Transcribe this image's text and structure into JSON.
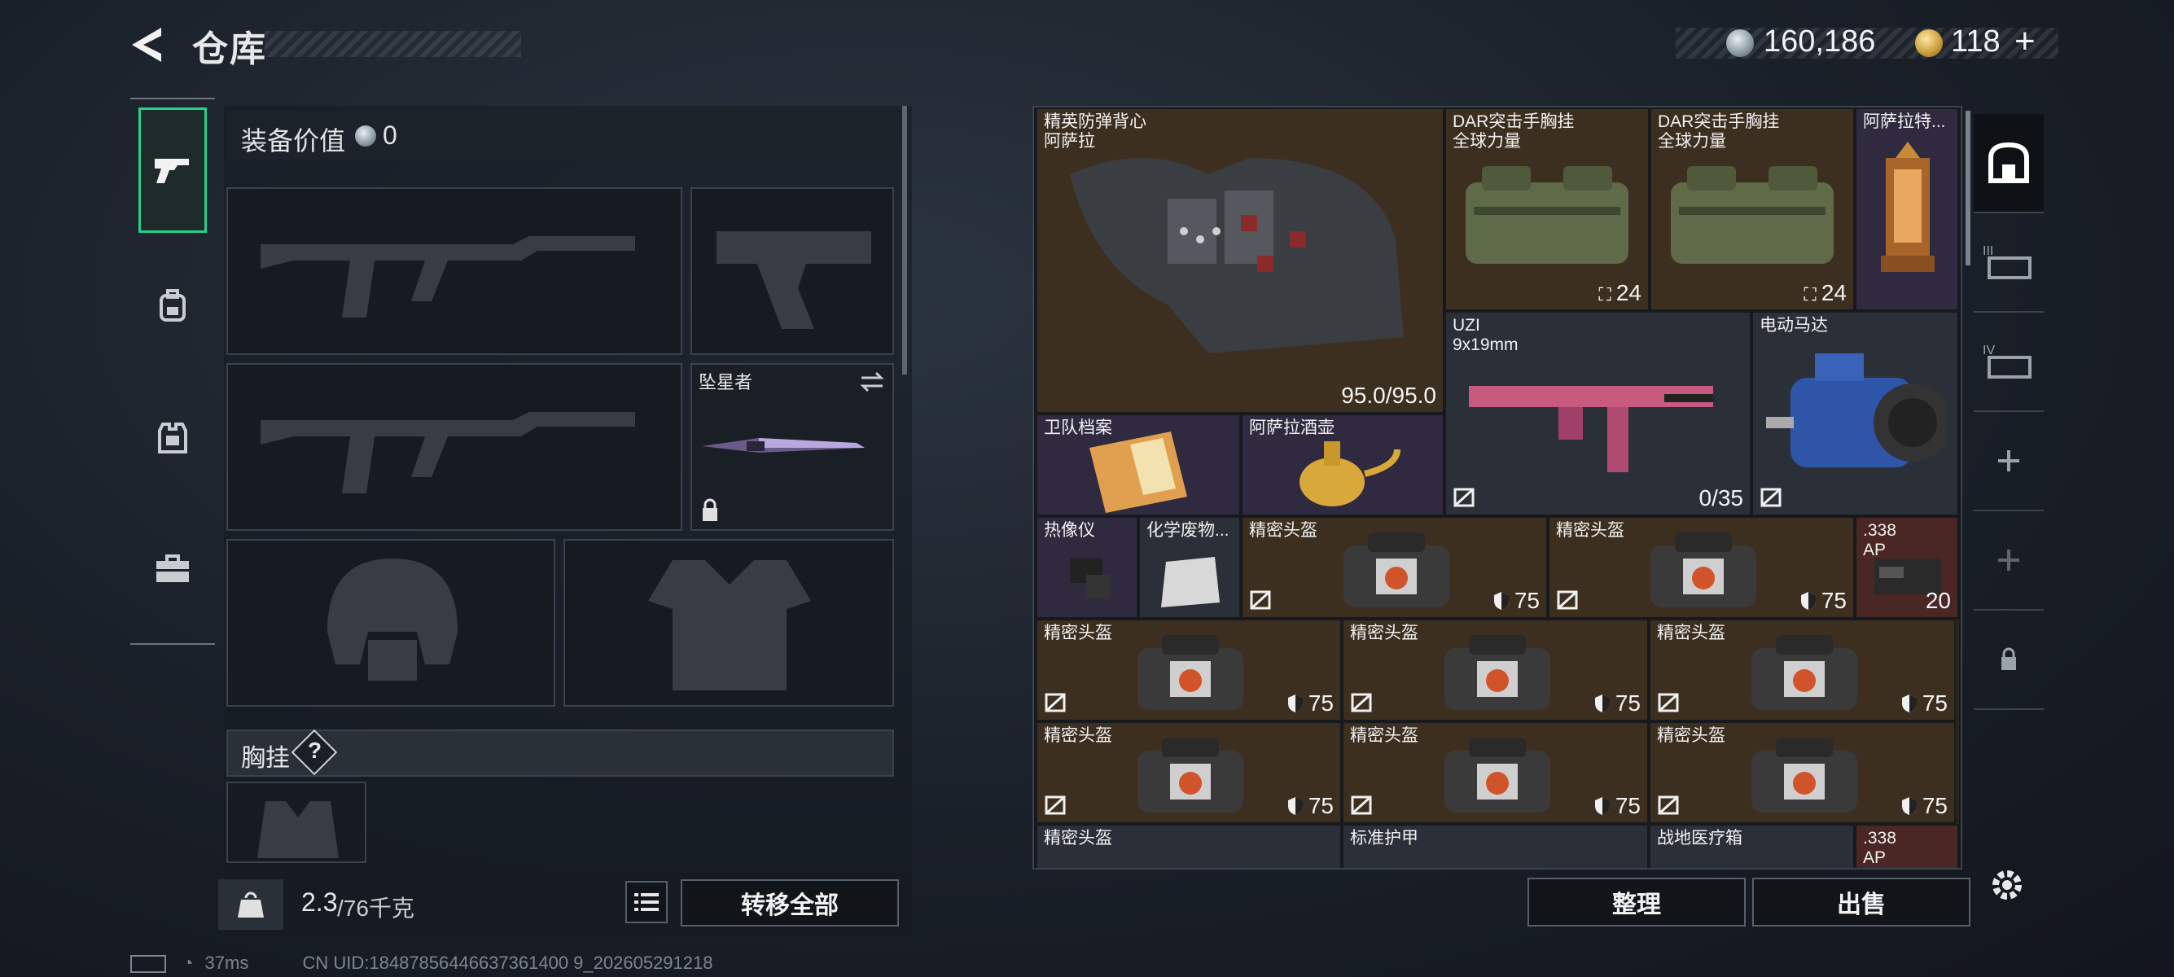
{
  "header": {
    "title": "仓库",
    "silver_amount": "160,186",
    "gold_amount": "118",
    "gold_plus": "+"
  },
  "left": {
    "equip_value_label": "装备价值",
    "equip_value": "0",
    "melee_name": "坠星者",
    "chest_rig_label": "胸挂",
    "chest_rig_help": "?",
    "weight_current": "2.3",
    "weight_max": "/76千克",
    "transfer_all": "转移全部"
  },
  "inventory": {
    "items": [
      {
        "name": "精英防弹背心\n阿萨拉",
        "br": "95.0/95.0"
      },
      {
        "name": "DAR突击手胸挂\n全球力量",
        "br": "24"
      },
      {
        "name": "DAR突击手胸挂\n全球力量",
        "br": "24"
      },
      {
        "name": "阿萨拉特...",
        "br": ""
      },
      {
        "name": "UZI\n9x19mm",
        "br": "0/35"
      },
      {
        "name": "电动马达",
        "br": ""
      },
      {
        "name": "卫队档案",
        "br": ""
      },
      {
        "name": "阿萨拉酒壶",
        "br": ""
      },
      {
        "name": "热像仪",
        "br": ""
      },
      {
        "name": "化学废物...",
        "br": ""
      },
      {
        "name": "精密头盔",
        "br": "75"
      },
      {
        "name": "精密头盔",
        "br": "75"
      },
      {
        "name": ".338\nAP",
        "br": "20"
      },
      {
        "name": "精密头盔",
        "br": "75"
      },
      {
        "name": "精密头盔",
        "br": "75"
      },
      {
        "name": "精密头盔",
        "br": "75"
      },
      {
        "name": "精密头盔",
        "br": "75"
      },
      {
        "name": "精密头盔",
        "br": "75"
      },
      {
        "name": "精密头盔",
        "br": "75"
      },
      {
        "name": "精密头盔",
        "br": ""
      },
      {
        "name": "标准护甲",
        "br": ""
      },
      {
        "name": "战地医疗箱",
        "br": ""
      },
      {
        "name": ".338\nAP",
        "br": ""
      }
    ],
    "sort_button": "整理",
    "sell_button": "出售"
  },
  "right_tabs": [
    "III",
    "IV"
  ],
  "status": {
    "ping": "37ms",
    "uid": "CN UID:18487856446637361400 9_202605291218"
  },
  "colors": {
    "accent_green": "#23d18b",
    "gray_cell": "#2b3038",
    "brown_cell": "#3b2e1f",
    "purple_cell": "#2f2a3f",
    "red_cell": "#4a2624"
  }
}
